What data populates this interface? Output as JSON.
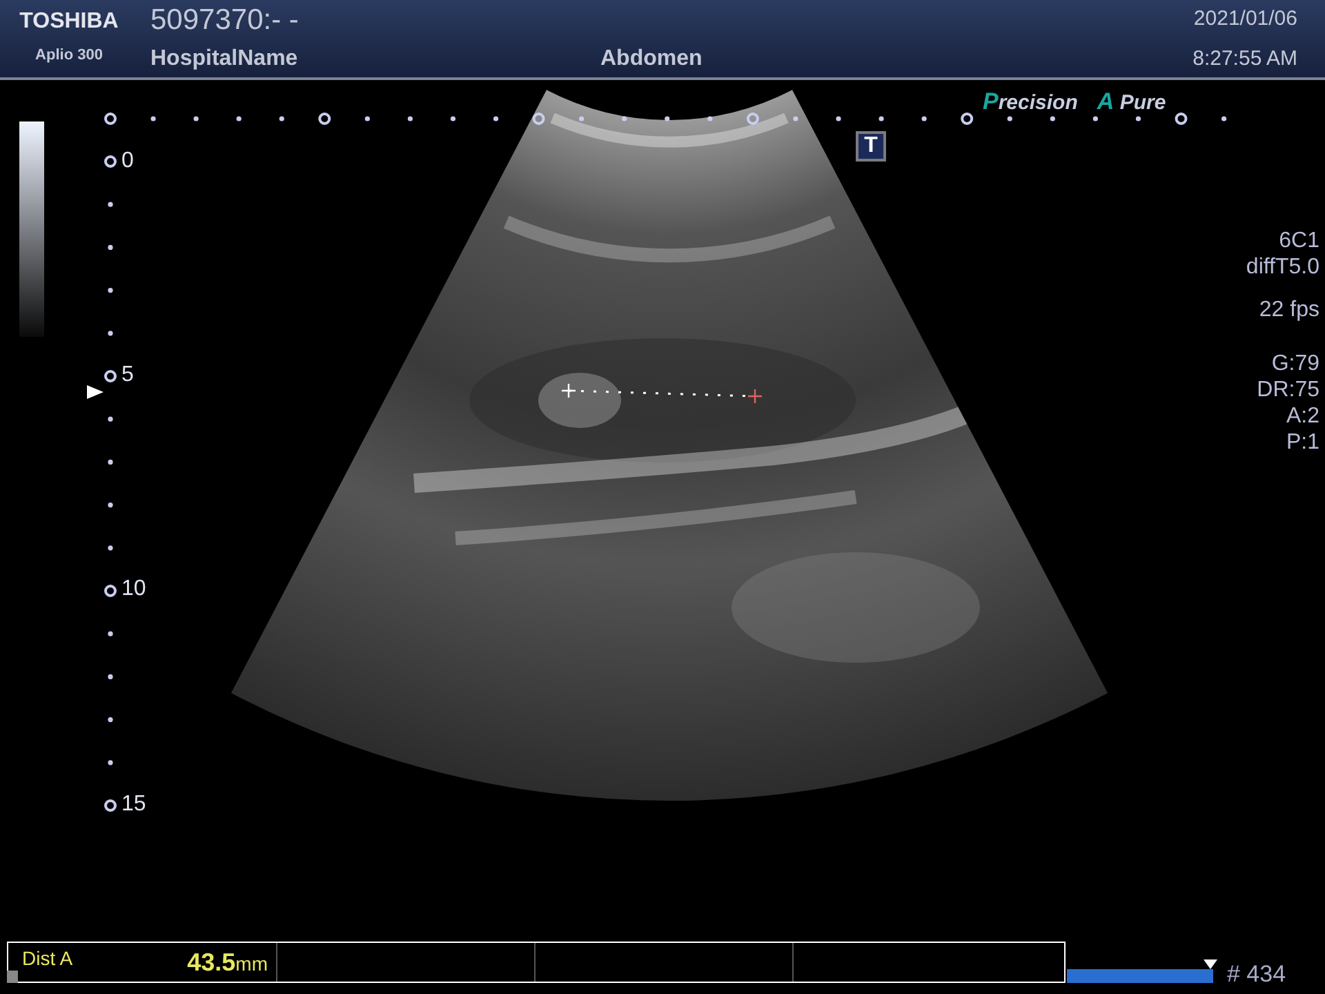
{
  "header": {
    "brand": "TOSHIBA",
    "model": "Aplio 300",
    "patient_id": "5097370:- -",
    "hospital": "HospitalName",
    "exam": "Abdomen",
    "date": "2021/01/06",
    "time": "8:27:55 AM"
  },
  "logos": [
    "Precision",
    "A Pure"
  ],
  "marker_label": "T",
  "depth_labels": [
    "0",
    "5",
    "10",
    "15"
  ],
  "parameters": [
    [
      "6C1",
      "diffT5.0"
    ],
    [
      "22 fps"
    ],
    [
      "G:79",
      "DR:75",
      "A:2",
      "P:1"
    ]
  ],
  "measurements": [
    {
      "label": "Dist A",
      "value": "43.5",
      "unit": "mm"
    }
  ],
  "cine": {
    "level": 1,
    "frame": "# 434"
  }
}
